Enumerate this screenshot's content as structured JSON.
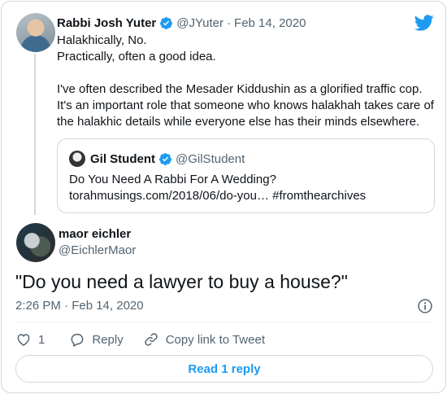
{
  "parent_tweet": {
    "author_name": "Rabbi Josh Yuter",
    "handle": "@JYuter",
    "separator": "·",
    "date": "Feb 14, 2020",
    "lines": [
      "Halakhically, No.",
      "Practically, often a good idea.",
      "",
      "I've often described the Mesader Kiddushin as a glorified traffic cop.",
      "It's an important role that someone who knows halakhah takes care of",
      "the halakhic details while everyone else has their minds elsewhere."
    ]
  },
  "quoted_tweet": {
    "author_name": "Gil Student",
    "handle": "@GilStudent",
    "line1": "Do You Need A Rabbi For A Wedding?",
    "line2": "torahmusings.com/2018/06/do-you… #fromthearchives"
  },
  "reply_tweet": {
    "author_name": "maor eichler",
    "handle": "@EichlerMaor",
    "text": "\"Do you need a lawyer to buy a house?\"",
    "timestamp": "2:26 PM · Feb 14, 2020"
  },
  "actions": {
    "like_count": "1",
    "reply_label": "Reply",
    "copy_link_label": "Copy link to Tweet"
  },
  "read_reply_label": "Read 1 reply",
  "colors": {
    "accent": "#1d9bf0",
    "muted": "#536471",
    "border": "#cfd9de"
  },
  "icons": [
    "twitter-logo-icon",
    "verified-badge-icon",
    "info-icon",
    "heart-icon",
    "reply-icon",
    "link-icon"
  ]
}
